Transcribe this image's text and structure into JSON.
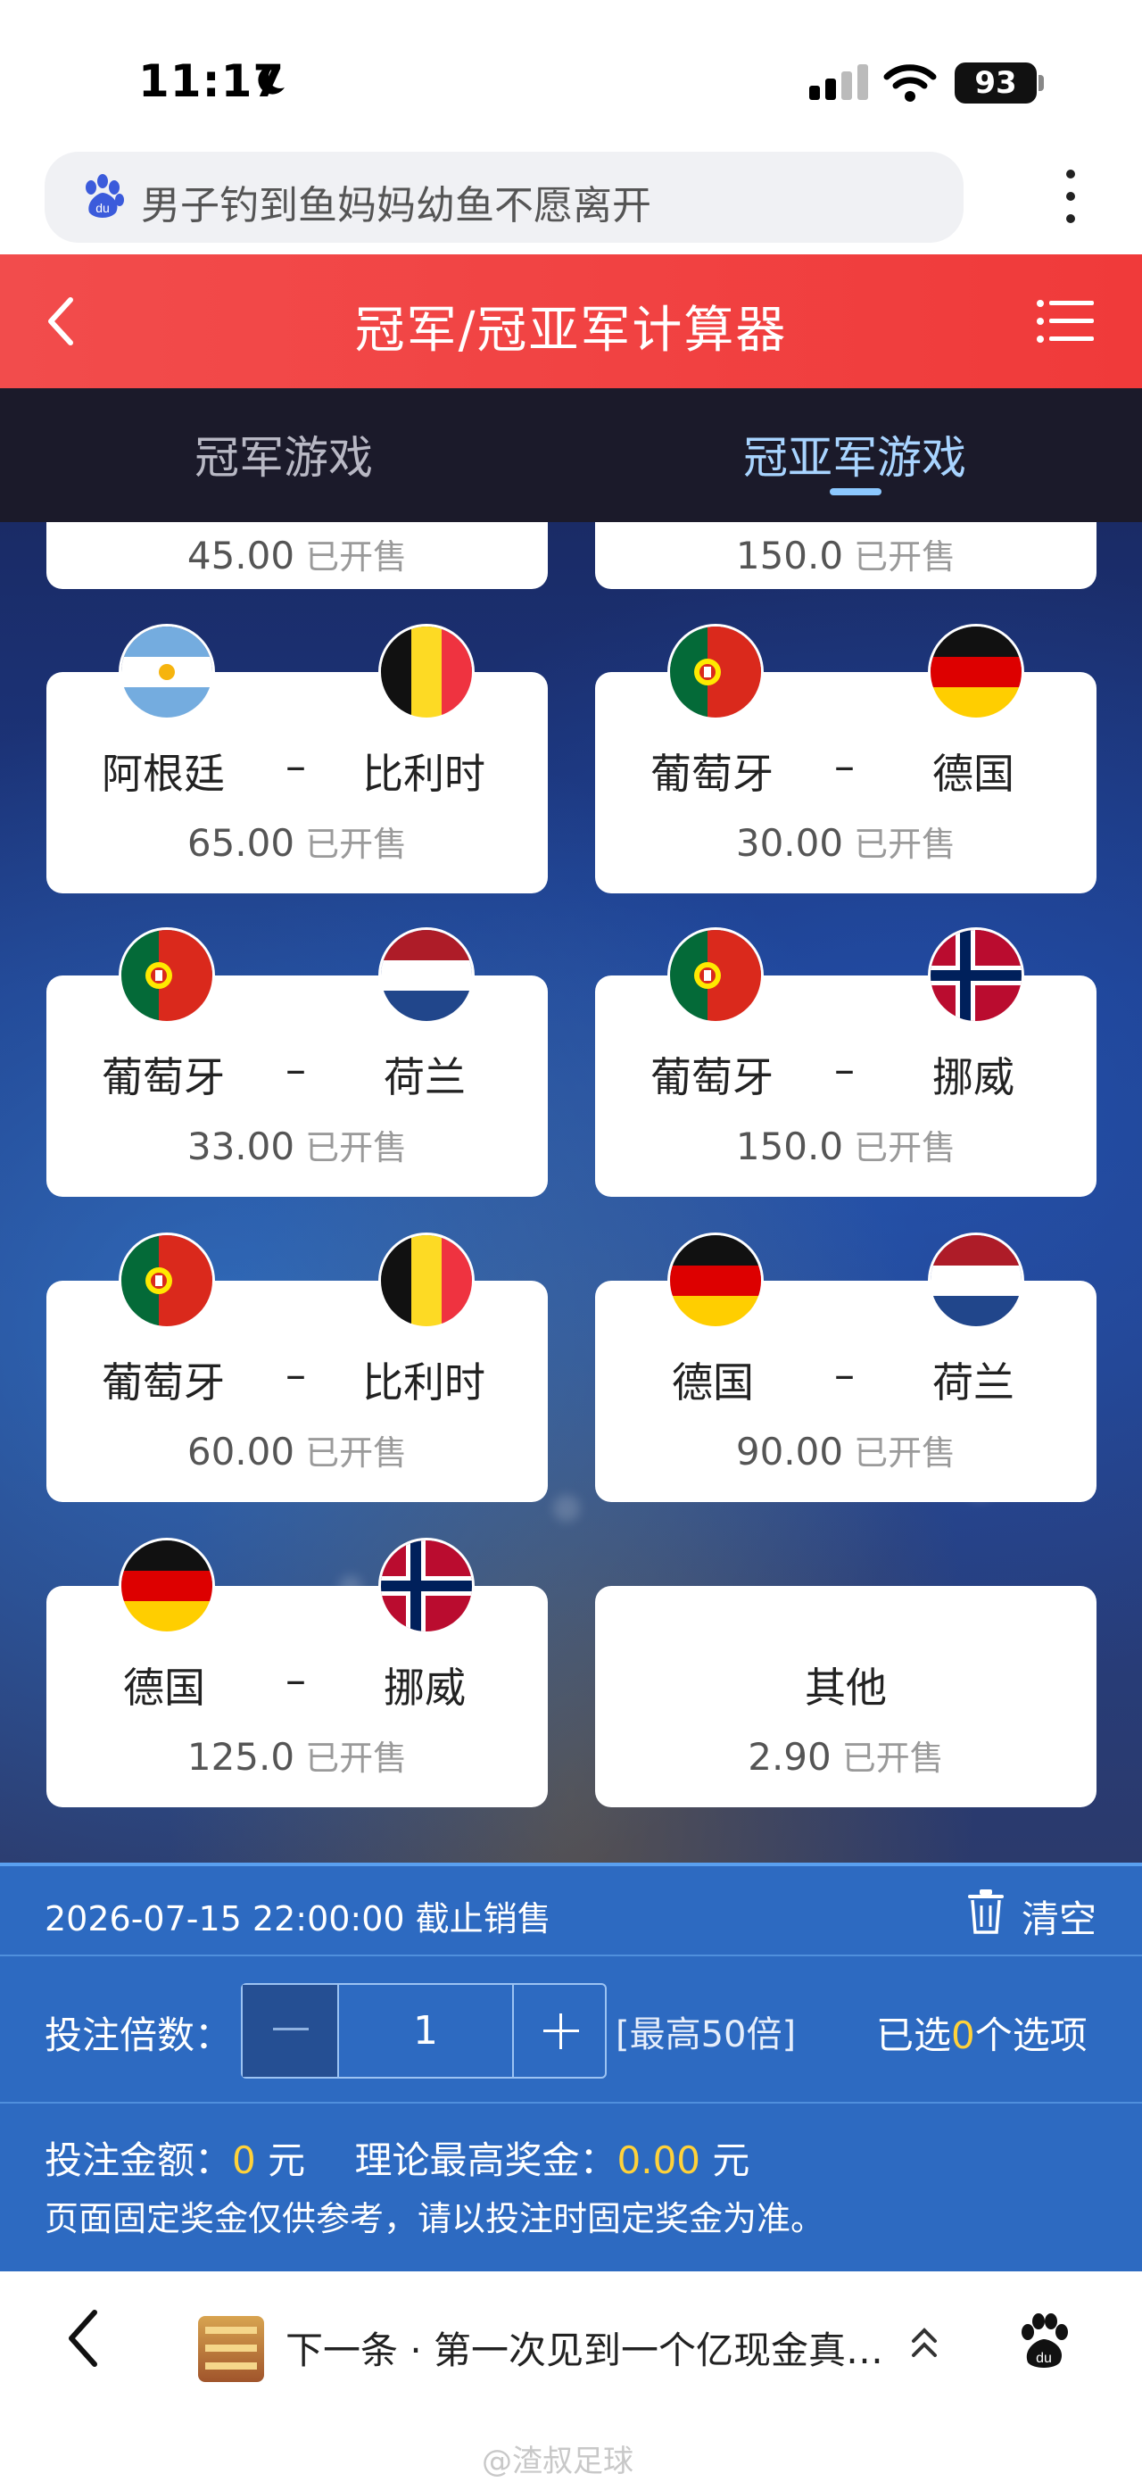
{
  "status": {
    "time": "11:17",
    "battery": "93"
  },
  "search": {
    "text": "男子钓到鱼妈妈幼鱼不愿离开"
  },
  "header": {
    "title": "冠军/冠亚军计算器"
  },
  "tabs": [
    {
      "label": "冠军游戏",
      "active": false
    },
    {
      "label": "冠亚军游戏",
      "active": true
    }
  ],
  "partial_cards": [
    {
      "odds": "45.00",
      "status": "已开售"
    },
    {
      "odds": "150.0",
      "status": "已开售"
    }
  ],
  "cards": [
    {
      "team1": "阿根廷",
      "team1_flag": "argentina",
      "separator": "–",
      "team2": "比利时",
      "team2_flag": "belgium",
      "odds": "65.00",
      "status": "已开售"
    },
    {
      "team1": "葡萄牙",
      "team1_flag": "portugal",
      "separator": "–",
      "team2": "德国",
      "team2_flag": "germany",
      "odds": "30.00",
      "status": "已开售"
    },
    {
      "team1": "葡萄牙",
      "team1_flag": "portugal",
      "separator": "–",
      "team2": "荷兰",
      "team2_flag": "netherlands",
      "odds": "33.00",
      "status": "已开售"
    },
    {
      "team1": "葡萄牙",
      "team1_flag": "portugal",
      "separator": "–",
      "team2": "挪威",
      "team2_flag": "norway",
      "odds": "150.0",
      "status": "已开售"
    },
    {
      "team1": "葡萄牙",
      "team1_flag": "portugal",
      "separator": "–",
      "team2": "比利时",
      "team2_flag": "belgium",
      "odds": "60.00",
      "status": "已开售"
    },
    {
      "team1": "德国",
      "team1_flag": "germany",
      "separator": "–",
      "team2": "荷兰",
      "team2_flag": "netherlands",
      "odds": "90.00",
      "status": "已开售"
    },
    {
      "team1": "德国",
      "team1_flag": "germany",
      "separator": "–",
      "team2": "挪威",
      "team2_flag": "norway",
      "odds": "125.0",
      "status": "已开售"
    },
    {
      "other": "其他",
      "odds": "2.90",
      "status": "已开售"
    }
  ],
  "deadline": {
    "text": "2026-07-15 22:00:00 截止销售",
    "clear_label": "清空"
  },
  "multiplier": {
    "label": "投注倍数：",
    "value": "1",
    "max": "[最高50倍]",
    "selected_prefix": "已选",
    "selected_count": "0",
    "selected_suffix": "个选项"
  },
  "amount": {
    "bet_label": "投注金额：",
    "bet_value": "0",
    "bet_unit": "元",
    "prize_label": "理论最高奖金：",
    "prize_value": "0.00",
    "prize_unit": "元",
    "note": "页面固定奖金仅供参考，请以投注时固定奖金为准。"
  },
  "bottom_nav": {
    "news": "下一条 · 第一次见到一个亿现金真…",
    "watermark": "@渣叔足球"
  },
  "colors": {
    "header_red": "#f03a3a",
    "panel_blue": "#2d6ac1",
    "tab_active": "#a8d4ff",
    "highlight_yellow": "#ffd23a"
  }
}
